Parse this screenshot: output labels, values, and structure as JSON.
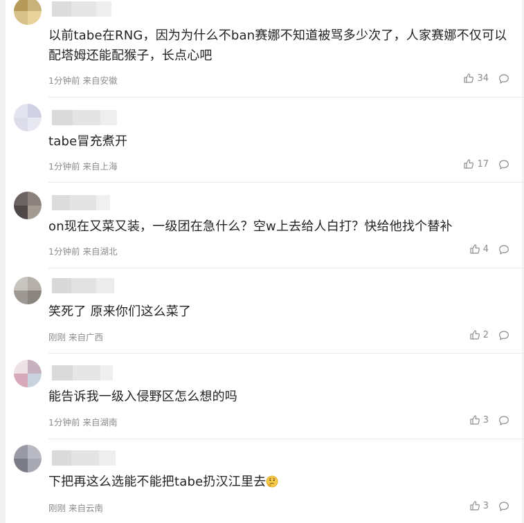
{
  "comments": [
    {
      "text": "以前tabe在RNG，因为为什么不ban赛娜不知道被骂多少次了，人家赛娜不仅可以配塔姆还能配猴子，长点心吧",
      "time": "1分钟前",
      "location": "来自安徽",
      "likes": "34",
      "avatar_colors": [
        "#b59a5a",
        "#c9b27a",
        "#d8c08a",
        "#e8d49a"
      ],
      "name_colors": [
        "#dcdcdc",
        "#e6e6e6",
        "#eeeeee"
      ]
    },
    {
      "text": "tabe冒充煮开",
      "time": "1分钟前",
      "location": "来自上海",
      "likes": "17",
      "avatar_colors": [
        "#e4e4ef",
        "#cfd0e2",
        "#dcdcea",
        "#e8e8f2"
      ],
      "name_colors": [
        "#dadada",
        "#e4e4e4",
        "#eeeeee"
      ]
    },
    {
      "text": "on现在又菜又装，一级团在急什么？空w上去给人白打？快给他找个替补",
      "time": "1分钟前",
      "location": "来自湖北",
      "likes": "4",
      "avatar_colors": [
        "#6a6361",
        "#8a817c",
        "#4e4747",
        "#a39a92"
      ],
      "name_colors": [
        "#dcdcdc",
        "#e4e4e4",
        "#f0f0f0"
      ]
    },
    {
      "text": "笑死了 原来你们这么菜了",
      "time": "刚刚",
      "location": "来自广西",
      "likes": "2",
      "avatar_colors": [
        "#c8c4c0",
        "#b6b0aa",
        "#9d9893",
        "#8a847e"
      ],
      "name_colors": [
        "#d8d8d8",
        "#e2e2e2",
        "#ececec"
      ]
    },
    {
      "text": "能告诉我一级入侵野区怎么想的吗",
      "time": "1分钟前",
      "location": "来自湖南",
      "likes": "3",
      "avatar_colors": [
        "#efe2e6",
        "#c8b1bf",
        "#d8a9bb",
        "#c9d3dd"
      ],
      "name_colors": [
        "#dadada",
        "#e6e6e6",
        "#efefef"
      ]
    },
    {
      "text": "下把再这么选能不能把tabe扔汉江里去",
      "emoji": "thinking-face-icon",
      "time": "刚刚",
      "location": "来自云南",
      "likes": "3",
      "avatar_colors": [
        "#9a9aa6",
        "#b9b9c4",
        "#7c7c88",
        "#a8a8b2"
      ],
      "name_colors": [
        "#dadada",
        "#e4e4e4",
        "#eeeeee"
      ]
    }
  ],
  "icons": {
    "like": "thumbs-up-icon",
    "reply": "comment-bubble-icon"
  },
  "colors": {
    "text": "#222222",
    "meta": "#8c8c8c",
    "divider": "#e8e8e8"
  }
}
